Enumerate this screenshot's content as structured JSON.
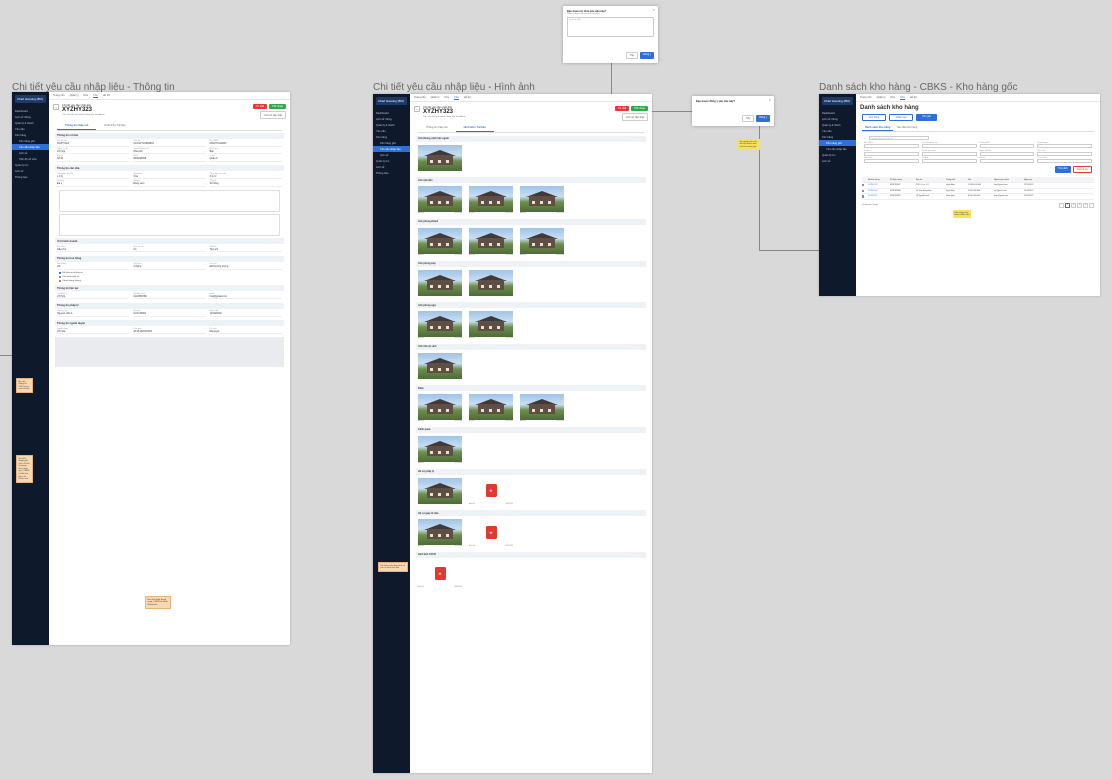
{
  "frames": {
    "info_title": "Chi tiết yêu cầu nhập liệu - Thông tin",
    "image_title": "Chi tiết yêu cầu nhập liệu - Hình ảnh",
    "warehouse_title": "Danh sách kho hàng - CBKS - Kho hàng gốc"
  },
  "sidebar": {
    "logo": "Chief Housing (BO)",
    "items": [
      "Dashboard",
      "Lịch sử thông",
      "Quản lý & thanh",
      "Yêu cầu",
      "Kho hàng",
      "Quản lý tìm",
      "Lịch sử",
      "Thông báo",
      "Đăng xuất"
    ],
    "sub_items": [
      "Kho hàng gốc",
      "Yêu cầu nhập liệu",
      "Lịch sử",
      "Tiến độ sở sửa"
    ]
  },
  "topnav": [
    "Trang chủ",
    "Quản lý",
    "Khu",
    "Kho",
    "Hỗ trợ",
    "Tiện ích"
  ],
  "detail": {
    "small_title": "Chi tiết yêu cầu nhập liệu",
    "code": "XYZHY323",
    "note": "Yêu cầu đã hoàn thành nhập liệu bởi Admin",
    "reject_label": "Từ chối",
    "approve_label": "Phê duyệt",
    "history_label": "Lịch sử cập nhật",
    "tabs": [
      "Thông tin nhập mô",
      "Hình ảnh / Tài liệu"
    ]
  },
  "info_sections": [
    {
      "title": "Thông tin cơ bản",
      "fields": [
        {
          "label": "Mã yêu cầu",
          "value": "XKZHY323"
        },
        {
          "label": "Tiêu đề",
          "value": "XLOGPYL8992893"
        },
        {
          "label": "Mã CBKS",
          "value": "KBGHYS12832"
        },
        {
          "label": "Người xử lý",
          "value": "Võ Hợp"
        },
        {
          "label": "Loại bất động sản",
          "value": "Nhà phố"
        },
        {
          "label": "Hình thức",
          "value": "Bán"
        },
        {
          "label": "Địa chỉ",
          "value": "Số 24"
        },
        {
          "label": "Số tờ",
          "value": "NDF293928"
        },
        {
          "label": "Quận",
          "value": "Quận 9"
        }
      ]
    },
    {
      "title": "Thông tin căn nhà",
      "fields": [
        {
          "label": "Tổng diện tích đất",
          "value": "1.3 tỷ"
        },
        {
          "label": "Số phòng",
          "value": "3 ha"
        },
        {
          "label": "Tổng diện tích sàn",
          "value": "3.2 m²"
        },
        {
          "label": "Số tầng",
          "value": "Đá 1"
        },
        {
          "label": "Hướng",
          "value": "Đông nam"
        },
        {
          "label": "Pháp lý",
          "value": "Sổ hồng"
        }
      ]
    },
    {
      "title": "Vị trí kinh doanh",
      "fields": [
        {
          "label": "Đặc điểm",
          "value": "Gần chợ"
        },
        {
          "label": "Hẻm xe hơi",
          "value": "Có"
        },
        {
          "label": "Mặt tiền",
          "value": "Tiện ích"
        }
      ]
    },
    {
      "title": "Thông tin hoa hồng",
      "fields": [
        {
          "label": "Hoa hồng",
          "value": "2%"
        },
        {
          "label": "Thời hạn",
          "value": "3 tháng"
        },
        {
          "label": "Ghi chú",
          "value": "Đã thương lượng"
        }
      ]
    },
    {
      "title": "Thông tin liên lạc",
      "fields": [
        {
          "label": "Tên liên hệ",
          "value": "Võ Hợp"
        },
        {
          "label": "Số điện thoại",
          "value": "0123456789"
        },
        {
          "label": "Email",
          "value": "hop@gmail.com"
        }
      ]
    },
    {
      "title": "Thông tin pháp lý",
      "fields": [
        {
          "label": "Chủ sở hữu",
          "value": "Nguyễn Văn A"
        },
        {
          "label": "Số giấy",
          "value": "GCN 28392"
        },
        {
          "label": "Ngày cấp",
          "value": "12/03/2020"
        }
      ]
    },
    {
      "title": "Thông tin người duyệt",
      "fields": [
        {
          "label": "Người duyệt",
          "value": "Võ Hợp"
        },
        {
          "label": "Thời gian",
          "value": "10:25 28/03/2023"
        },
        {
          "label": "Kết quả",
          "value": "Đã duyệt"
        }
      ]
    }
  ],
  "checkboxes": [
    "Đã kiểm tra thông tin",
    "Xác nhận giấy tờ",
    "Khách hàng đồng ý"
  ],
  "photo_sections": [
    {
      "title": "Ảnh khung cảnh bên ngoài",
      "items": [
        "photo"
      ]
    },
    {
      "title": "Ảnh mặt tiền",
      "items": [
        "photo",
        "photo",
        "photo"
      ]
    },
    {
      "title": "Ảnh phòng khách",
      "items": [
        "photo",
        "photo",
        "photo"
      ]
    },
    {
      "title": "Ảnh phòng bếp",
      "items": [
        "photo",
        "photo"
      ]
    },
    {
      "title": "Ảnh phòng ngủ",
      "items": [
        "photo",
        "photo"
      ]
    },
    {
      "title": "Ảnh nhà vệ sinh",
      "items": [
        "photo"
      ]
    },
    {
      "title": "Khác",
      "items": [
        "photo",
        "photo",
        "photo"
      ]
    },
    {
      "title": "Cảnh quan",
      "items": [
        "photo"
      ]
    },
    {
      "title": "Hồ sơ pháp lý",
      "items": [
        "photo",
        "pdf"
      ]
    },
    {
      "title": "Hồ sơ giấy tờ nhà",
      "items": [
        "photo",
        "pdf"
      ]
    },
    {
      "title": "Hình ảnh CCCD",
      "items": [
        "pdf"
      ]
    }
  ],
  "photo_caption": {
    "name": "Ảnh nhà",
    "date": "12/03/2023"
  },
  "modal_reject": {
    "title": "Bạn muốn từ chối yêu cầu này?",
    "subtitle": "Nhập lý do từ chối yêu cầu nhập liệu",
    "placeholder": "Lý do từ chối",
    "cancel": "Hủy",
    "confirm": "Đồng ý"
  },
  "modal_approve": {
    "title": "Bạn muốn đồng ý yêu cầu này?",
    "cancel": "Hủy",
    "confirm": "Đồng ý"
  },
  "warehouse": {
    "title": "Danh sách kho hàng",
    "tabs": [
      "Kho hàng",
      "Phân loại",
      "Kho gốc"
    ],
    "subtabs": [
      "Danh sách kho hàng",
      "Yêu cầu kho hàng"
    ],
    "search_placeholder": "Tìm kiếm theo mã, địa chỉ",
    "filter_labels": [
      "Mã CBKS",
      "Loại bất động sản",
      "Phường/Xã",
      "Quận/Huyện",
      "Hướng",
      "Người phụ trách",
      "Ngày bắt đầu",
      "Diện tích",
      "Hình thức",
      "Pháp lý",
      "Giá từ",
      "Trạng thái"
    ],
    "search_btn": "Tìm kiếm",
    "reset_btn": "Xóa bộ lọc",
    "columns": [
      "",
      "Mã kho hàng",
      "Số điện thoại",
      "Địa chỉ",
      "Trạng thái",
      "Giá",
      "Người phụ trách",
      "Ngày tạo"
    ],
    "rows": [
      [
        "",
        "XYZHY323",
        "0918263847",
        "123 Lê Lợi, Q.1",
        "Hoạt động",
        "11.000.000.000",
        "hop@gmail.com",
        "12/11/2022"
      ],
      [
        "",
        "XYZHY324",
        "0918263848",
        "45 Trần Hưng Đạo",
        "Hoạt động",
        "9.500.000.000",
        "an@gmail.com",
        "14/11/2022"
      ],
      [
        "",
        "XYZHY325",
        "0918263849",
        "78 Nguyễn Huệ",
        "Hoạt động",
        "8.200.000.000",
        "binh@gmail.com",
        "18/11/2022"
      ]
    ],
    "pagination": [
      "‹",
      "1",
      "2",
      "3",
      "4",
      "›"
    ],
    "page_size": "10 bản ghi / trang"
  },
  "notes": {
    "note1": "Ấn vào thông tin PDF mở ra xem tài liệu",
    "note2": "Sau khi duyệt yêu cầu sẽ hiển thị trong kho hàng gốc, CBKS có thể tạo yêu cầu chỉnh sửa",
    "note3": "Sau khi nhập duyệt xong, CBKS sẽ nhận thông báo",
    "note4": "Khi bấm vào từng ảnh sẽ mở ra xem ảnh lớn",
    "note5": "Khi duyệt yêu cầu, dữ liệu được đưa vào kho hàng gốc",
    "note6": "Kho hàng mới được thêm vào"
  },
  "colors": {
    "primary": "#2f6fd6",
    "danger": "#e53935",
    "success": "#2eaa4a",
    "sidebar": "#0e1a2b",
    "canvas": "#d9d9d9"
  }
}
